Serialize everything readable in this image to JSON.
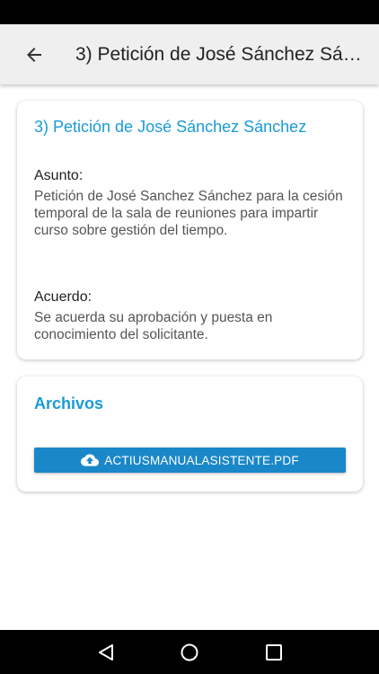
{
  "app_bar": {
    "title": "3) Petición de José Sánchez Sánchez",
    "back_icon": "arrow-left-icon"
  },
  "detail": {
    "title": "3) Petición de José Sánchez Sánchez",
    "asunto_label": "Asunto:",
    "asunto_text": "Petición de José Sanchez Sánchez para la cesión temporal de la sala de reuniones para impartir curso sobre gestión del tiempo.",
    "acuerdo_label": "Acuerdo:",
    "acuerdo_text": "Se acuerda su aprobación y puesta en conocimiento del solicitante."
  },
  "files": {
    "title": "Archivos",
    "items": [
      {
        "label": "ACTIUSMANUALASISTENTE.PDF",
        "icon": "cloud-upload-icon"
      }
    ]
  },
  "nav": {
    "back_icon": "triangle-back-icon",
    "home_icon": "circle-home-icon",
    "recents_icon": "square-recents-icon"
  },
  "colors": {
    "accent": "#1a9bd7",
    "button": "#1a87c9",
    "app_bar": "#efefef"
  }
}
